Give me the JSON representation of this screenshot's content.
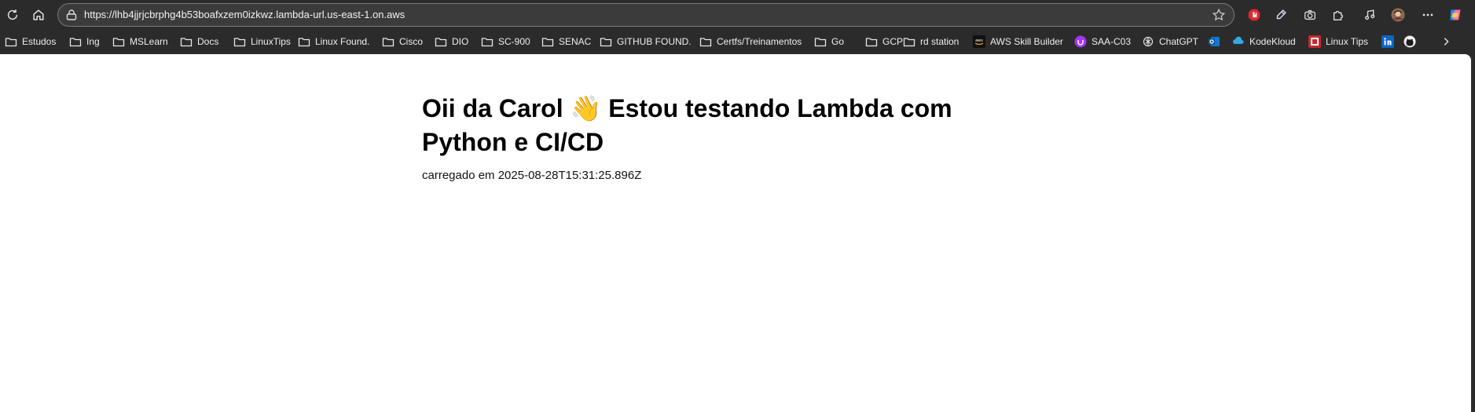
{
  "browser": {
    "url": "https://lhb4jjrjcbrphg4b53boafxzem0izkwz.lambda-url.us-east-1.on.aws",
    "bookmarks": [
      {
        "label": "Estudos",
        "icon": "folder-icon"
      },
      {
        "label": "Ing",
        "icon": "folder-icon"
      },
      {
        "label": "MSLearn",
        "icon": "folder-icon"
      },
      {
        "label": "Docs",
        "icon": "folder-icon"
      },
      {
        "label": "LinuxTips",
        "icon": "folder-icon"
      },
      {
        "label": "Linux Found.",
        "icon": "folder-icon"
      },
      {
        "label": "Cisco",
        "icon": "folder-icon"
      },
      {
        "label": "DIO",
        "icon": "folder-icon"
      },
      {
        "label": "SC-900",
        "icon": "folder-icon"
      },
      {
        "label": "SENAC",
        "icon": "folder-icon"
      },
      {
        "label": "GITHUB FOUND.",
        "icon": "folder-icon"
      },
      {
        "label": "Certfs/Treinamentos",
        "icon": "folder-icon"
      },
      {
        "label": "Go",
        "icon": "folder-icon"
      },
      {
        "label": "GCP",
        "icon": "folder-icon"
      },
      {
        "label": "rd station",
        "icon": "folder-icon"
      },
      {
        "label": "AWS Skill Builder",
        "icon": "aws-icon"
      },
      {
        "label": "SAA-C03",
        "icon": "udemy-icon"
      },
      {
        "label": "ChatGPT",
        "icon": "chatgpt-icon"
      },
      {
        "label": "",
        "icon": "outlook-icon"
      },
      {
        "label": "KodeKloud",
        "icon": "kodekloud-icon"
      },
      {
        "label": "Linux Tips",
        "icon": "linuxtips-icon"
      },
      {
        "label": "",
        "icon": "linkedin-icon"
      },
      {
        "label": "",
        "icon": "github-icon"
      }
    ]
  },
  "page": {
    "heading": "Oii da Carol 👋 Estou testando Lambda com Python e CI/CD",
    "loaded_text": "carregado em 2025-08-28T15:31:25.896Z"
  }
}
